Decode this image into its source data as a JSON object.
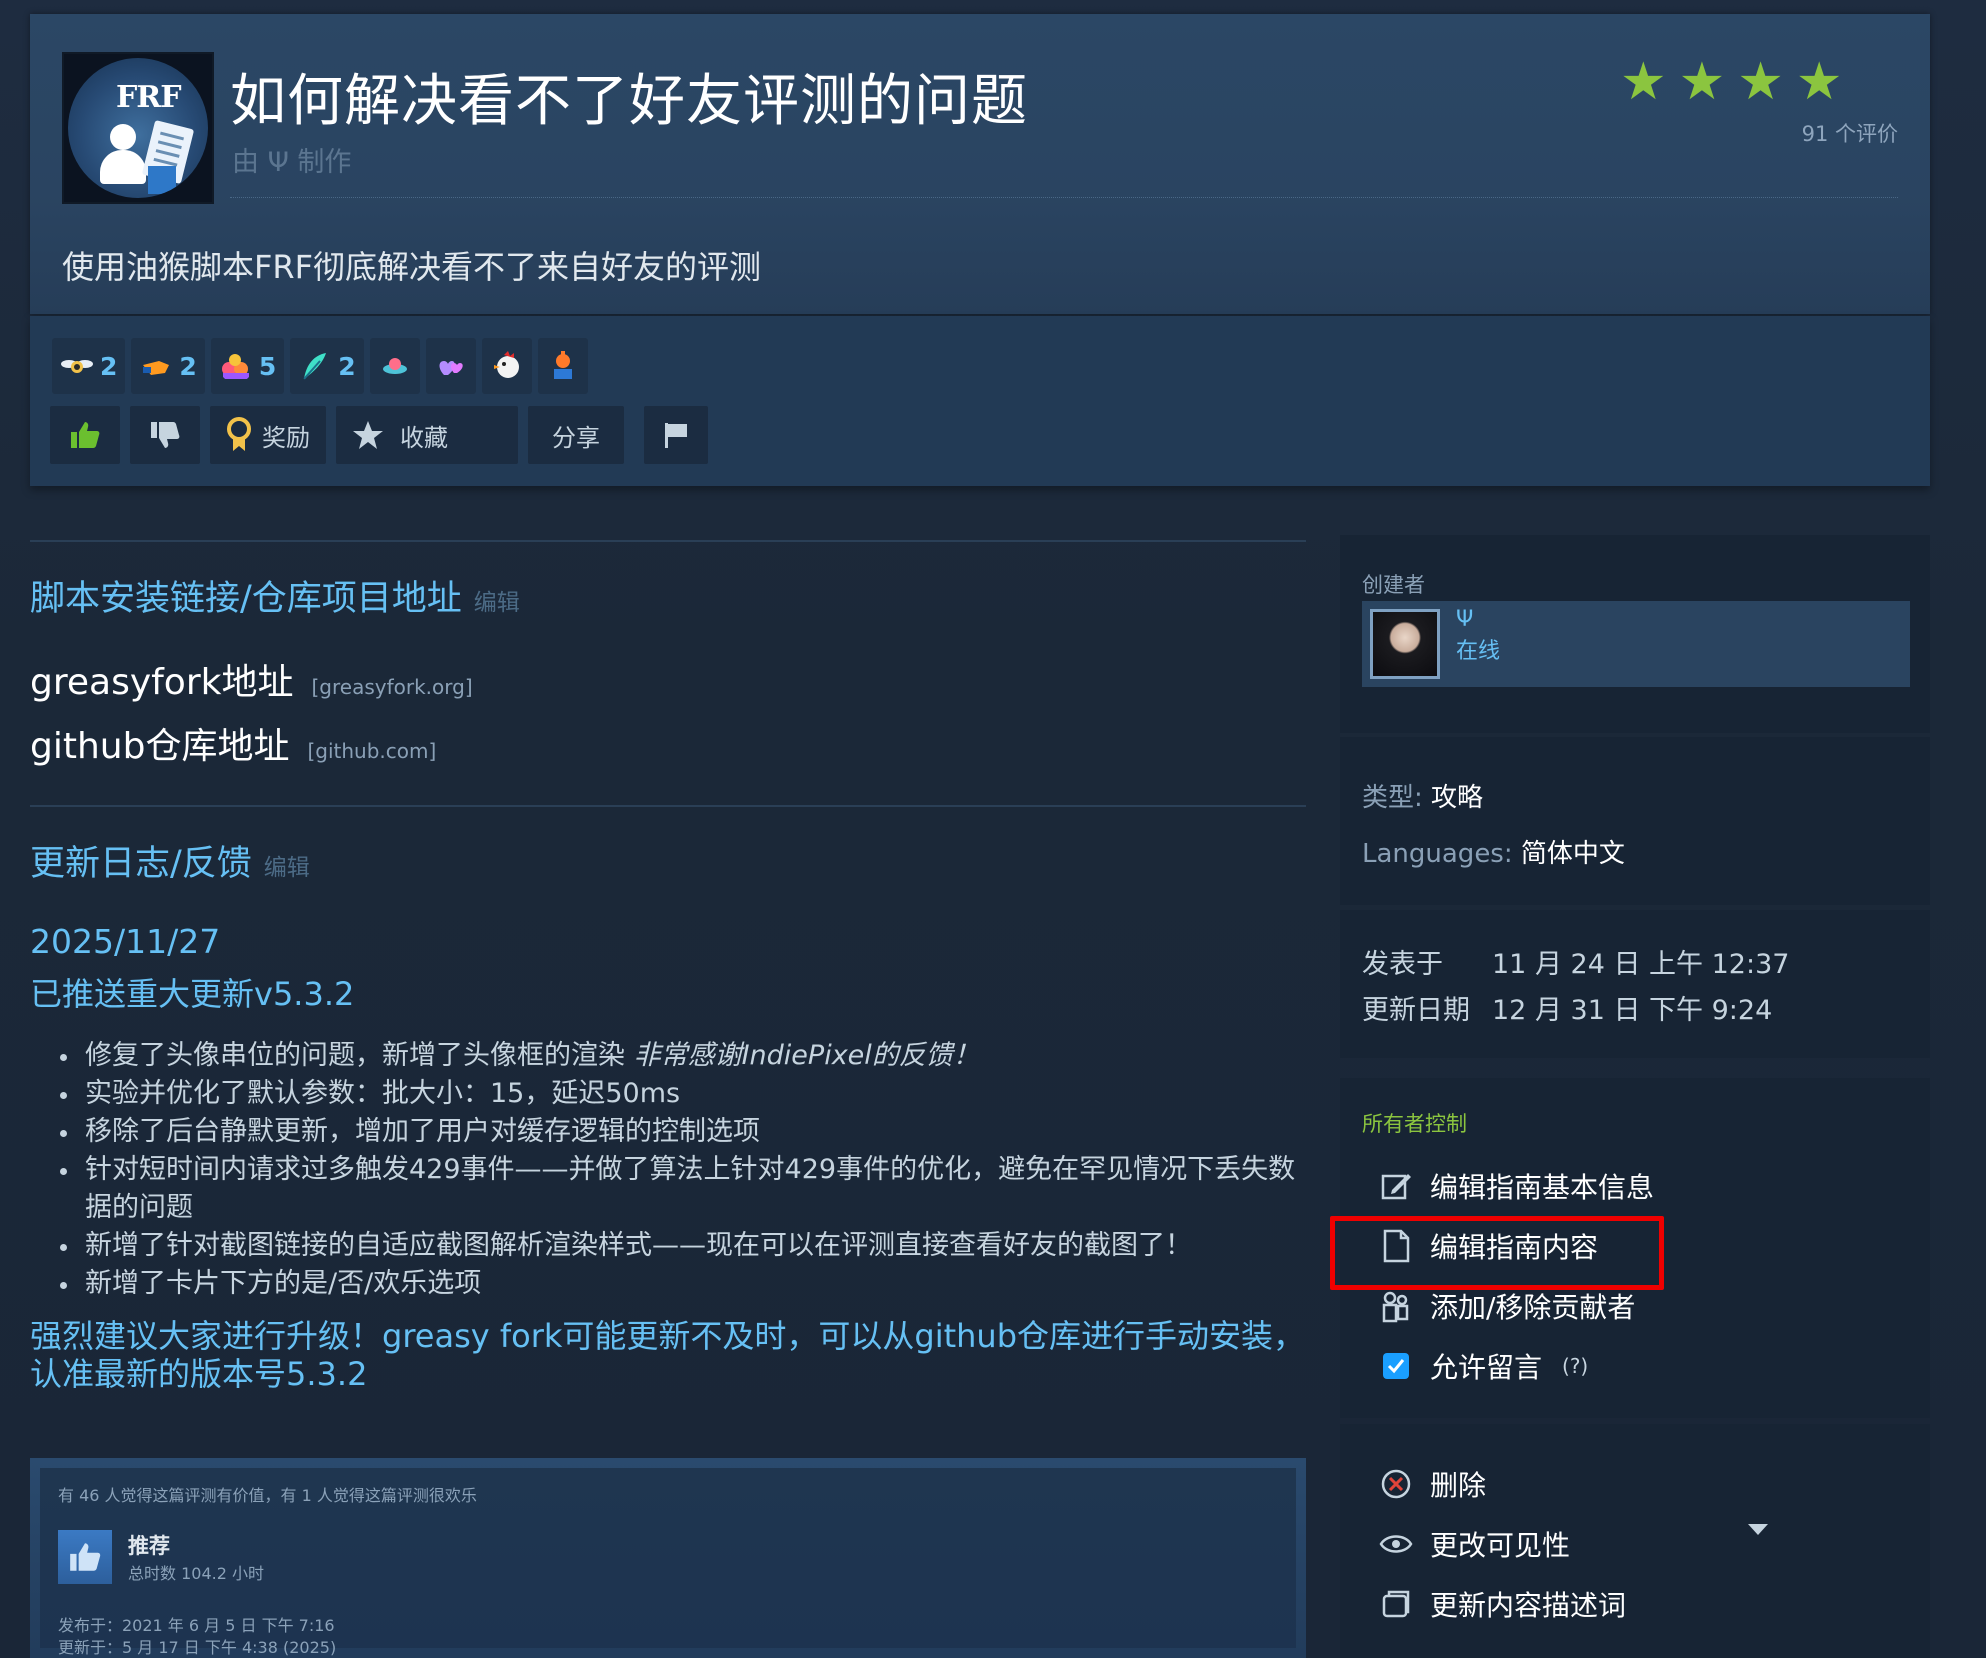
{
  "header": {
    "logo_text": "FRF",
    "title": "如何解决看不了好友评测的问题",
    "author": "由 Ψ 制作",
    "stars": [
      "★",
      "★",
      "★",
      "★"
    ],
    "rating_count": "91 个评价",
    "description": "使用油猴脚本FRF彻底解决看不了来自好友的评测",
    "colors": {
      "star": "#8bc53f",
      "accent": "#66c0f4",
      "highlight": "#f00000"
    }
  },
  "awards": [
    {
      "icon": "winged-award-icon",
      "count": "2"
    },
    {
      "icon": "hand-award-icon",
      "count": "2"
    },
    {
      "icon": "mixed-award-icon",
      "count": "5"
    },
    {
      "icon": "feather-award-icon",
      "count": "2"
    },
    {
      "icon": "ufo-award-icon",
      "count": ""
    },
    {
      "icon": "hearts-award-icon",
      "count": ""
    },
    {
      "icon": "chicken-award-icon",
      "count": ""
    },
    {
      "icon": "trophy-award-icon",
      "count": ""
    }
  ],
  "actions": {
    "award": "奖励",
    "favorite": "收藏",
    "share": "分享"
  },
  "sections": {
    "links": {
      "title": "脚本安装链接/仓库项目地址",
      "edit": "编辑",
      "items": [
        {
          "text": "greasyfork地址",
          "domain": "[greasyfork.org]"
        },
        {
          "text": "github仓库地址",
          "domain": "[github.com]"
        }
      ]
    },
    "changelog": {
      "title": "更新日志/反馈",
      "edit": "编辑",
      "date": "2025/11/27",
      "headline": "已推送重大更新v5.3.2",
      "items": [
        {
          "text": "修复了头像串位的问题，新增了头像框的渲染 ",
          "italic": "非常感谢IndiePixel的反馈！"
        },
        {
          "text": "实验并优化了默认参数：批大小：15，延迟50ms",
          "italic": ""
        },
        {
          "text": "移除了后台静默更新，增加了用户对缓存逻辑的控制选项",
          "italic": ""
        },
        {
          "text": "针对短时间内请求过多触发429事件——并做了算法上针对429事件的优化，避免在罕见情况下丢失数据的问题",
          "italic": ""
        },
        {
          "text": "新增了针对截图链接的自适应截图解析渲染样式——现在可以在评测直接查看好友的截图了！",
          "italic": ""
        },
        {
          "text": "新增了卡片下方的是/否/欢乐选项",
          "italic": ""
        }
      ],
      "recommendation": "强烈建议大家进行升级！greasy fork可能更新不及时，可以从github仓库进行手动安装，认准最新的版本号5.3.2"
    }
  },
  "review_preview": {
    "meta": "有 46 人觉得这篇评测有价值，有 1 人觉得这篇评测很欢乐",
    "recommend": "推荐",
    "hours": "总时数 104.2 小时",
    "posted": "发布于：2021 年 6 月 5 日 下午 7:16",
    "updated": "更新于：5 月 17 日 下午 4:38 (2025)"
  },
  "sidebar": {
    "creator": {
      "label": "创建者",
      "name": "Ψ",
      "status": "在线"
    },
    "meta": {
      "type_key": "类型: ",
      "type_val": "攻略",
      "lang_key": "Languages: ",
      "lang_val": "简体中文"
    },
    "dates": {
      "posted_key": "发表于",
      "posted_val": "11 月 24 日 上午 12:37",
      "updated_key": "更新日期",
      "updated_val": "12 月 31 日 下午 9:24"
    },
    "owner": {
      "title": "所有者控制",
      "edit_info": "编辑指南基本信息",
      "edit_content": "编辑指南内容",
      "contributors": "添加/移除贡献者",
      "allow_comments": "允许留言",
      "allow_comments_help": "(?)",
      "allow_comments_checked": true
    },
    "danger": {
      "delete": "删除",
      "visibility": "更改可见性",
      "update_desc": "更新内容描述词"
    }
  }
}
